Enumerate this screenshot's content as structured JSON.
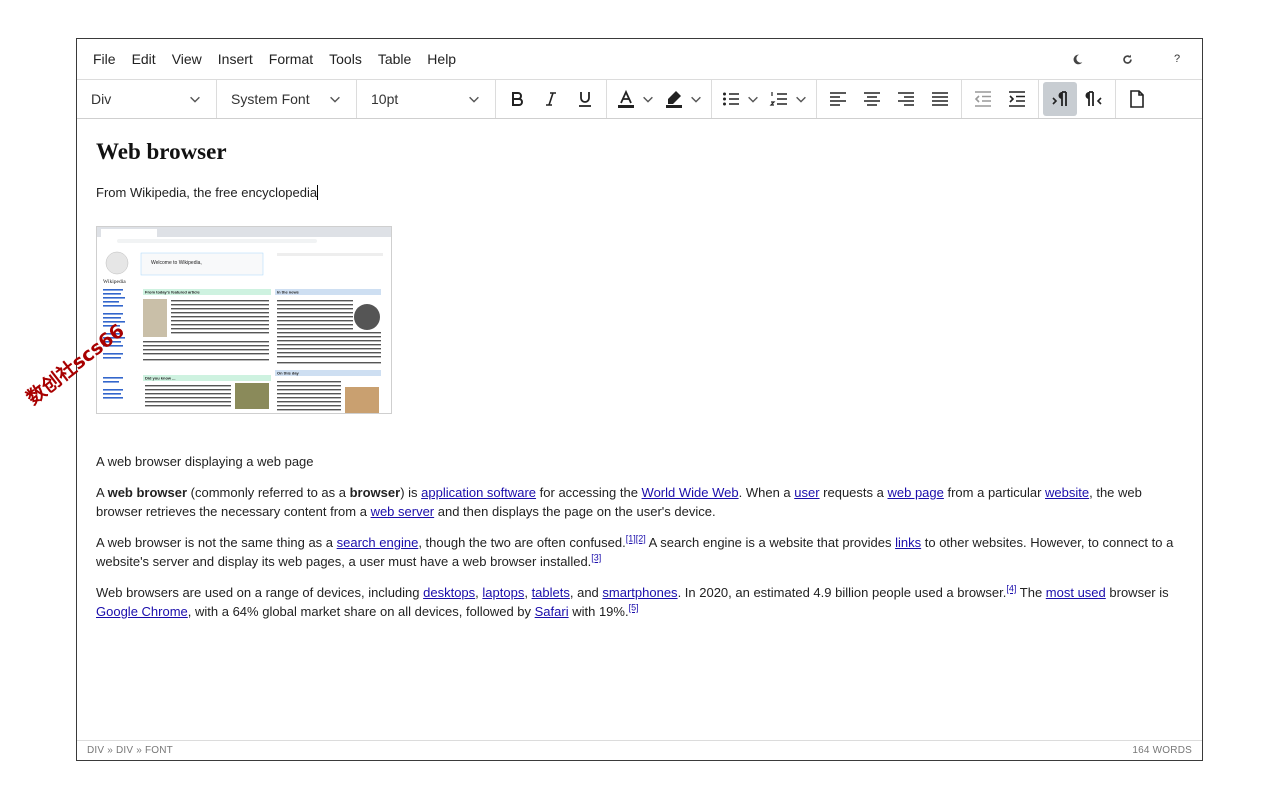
{
  "menu": {
    "items": [
      "File",
      "Edit",
      "View",
      "Insert",
      "Format",
      "Tools",
      "Table",
      "Help"
    ],
    "right_icons": [
      "moon-icon",
      "refresh-icon",
      "help-icon"
    ],
    "help_label": "?"
  },
  "toolbar": {
    "block_format": "Div",
    "font_family": "System Font",
    "font_size": "10pt",
    "buttons": [
      "bold",
      "italic",
      "underline",
      "text-color",
      "highlight-color",
      "bullet-list",
      "numbered-list",
      "align-left",
      "align-center",
      "align-right",
      "justify",
      "outdent",
      "indent",
      "ltr",
      "rtl",
      "new-document"
    ],
    "active": "ltr"
  },
  "document": {
    "title": "Web browser",
    "subtitle": "From Wikipedia, the free encyclopedia",
    "image_caption": "A web browser displaying a web page",
    "p1": {
      "t1": "A ",
      "b1": "web browser",
      "t2": " (commonly referred to as a ",
      "b2": "browser",
      "t3": ") is ",
      "l1": "application software",
      "t4": " for accessing the ",
      "l2": "World Wide Web",
      "t5": ". When a ",
      "l3": "user",
      "t6": " requests a ",
      "l4": "web page",
      "t7": " from a particular ",
      "l5": "website",
      "t8": ", the web browser retrieves the necessary content from a ",
      "l6": "web server",
      "t9": " and then displays the page on the user's device."
    },
    "p2": {
      "t1": "A web browser is not the same thing as a ",
      "l1": "search engine",
      "t2": ", though the two are often confused.",
      "s1": "[1]",
      "s2": "[2]",
      "t3": " A search engine is a website that provides ",
      "l2": "links",
      "t4": " to other websites. However, to connect to a website's server and display its web pages, a user must have a web browser installed.",
      "s3": "[3]"
    },
    "p3": {
      "t1": "Web browsers are used on a range of devices, including ",
      "l1": "desktops",
      "c1": ", ",
      "l2": "laptops",
      "c2": ", ",
      "l3": "tablets",
      "c3": ", and ",
      "l4": "smartphones",
      "t2": ". In 2020, an estimated 4.9 billion people used a browser.",
      "s1": "[4]",
      "t3": " The ",
      "l5": "most used",
      "t4": " browser is ",
      "l6": "Google Chrome",
      "t5": ", with a 64% global market share on all devices, followed by ",
      "l7": "Safari",
      "t6": " with 19%.",
      "s2": "[5]"
    }
  },
  "embedded_screenshot": {
    "logo": "Wikipedia",
    "welcome": "Welcome to Wikipedia,",
    "featured": "From today's featured article",
    "in_news": "In the news",
    "did_you_know": "Did you know ...",
    "on_this_day": "On this day"
  },
  "status": {
    "path": "DIV » DIV » FONT",
    "word_count": "164 WORDS"
  },
  "watermark": "数创社scs66",
  "colors": {
    "link": "#1a0dab",
    "active_button": "#c8cdd2",
    "watermark": "#a80000"
  }
}
